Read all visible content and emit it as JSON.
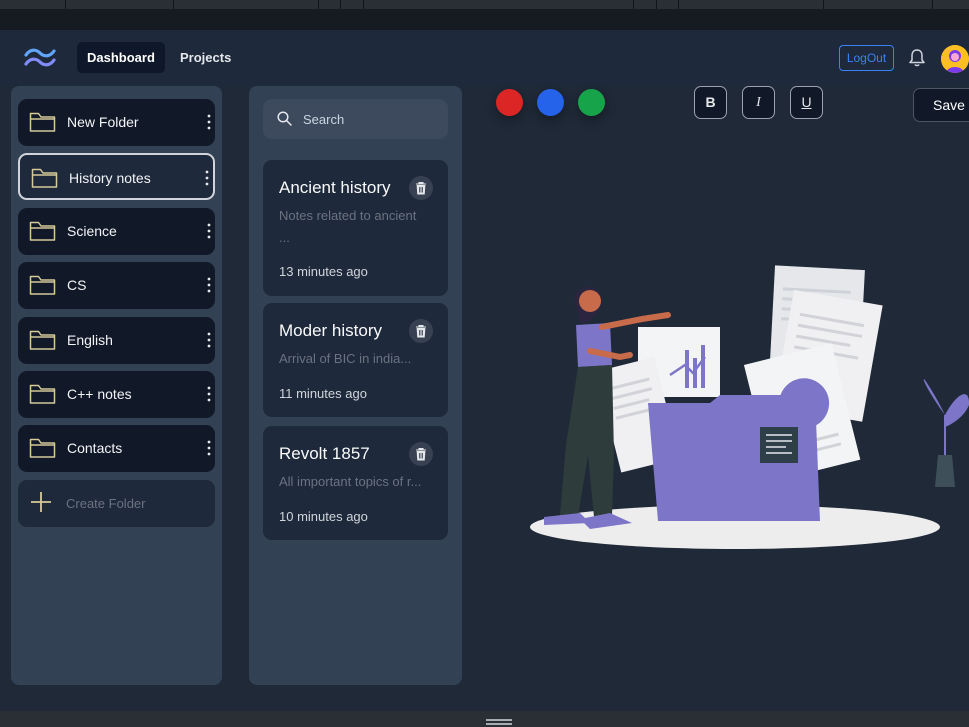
{
  "nav": {
    "dashboard": "Dashboard",
    "projects": "Projects",
    "logout": "LogOut"
  },
  "folders": [
    {
      "label": "New Folder",
      "selected": false
    },
    {
      "label": "History notes",
      "selected": true
    },
    {
      "label": "Science",
      "selected": false
    },
    {
      "label": "CS",
      "selected": false
    },
    {
      "label": "English",
      "selected": false
    },
    {
      "label": "C++ notes",
      "selected": false
    },
    {
      "label": "Contacts",
      "selected": false
    }
  ],
  "create_folder": "Create Folder",
  "search": {
    "placeholder": "Search",
    "value": ""
  },
  "notes": [
    {
      "title": "Ancient history",
      "snippet": "Notes related to ancient",
      "snippet2": "...",
      "time": "13 minutes ago"
    },
    {
      "title": "Moder history",
      "snippet": "Arrival of BIC in india...",
      "time": "11 minutes ago"
    },
    {
      "title": "Revolt 1857",
      "snippet": "All important topics of r...",
      "time": "10 minutes ago"
    }
  ],
  "color_options": [
    "#dc2626",
    "#2563eb",
    "#16a34a"
  ],
  "format": {
    "bold": "B",
    "italic": "I",
    "underline": "U"
  },
  "save_label": "Save",
  "colors": {
    "accent": "#3b82f6",
    "panel": "#334155",
    "card": "#1e293b",
    "bg": "#1f2937"
  },
  "icons": [
    "tailwind-logo-icon",
    "bell-icon",
    "folder-icon",
    "kebab-menu-icon",
    "plus-icon",
    "search-icon",
    "trash-icon"
  ]
}
